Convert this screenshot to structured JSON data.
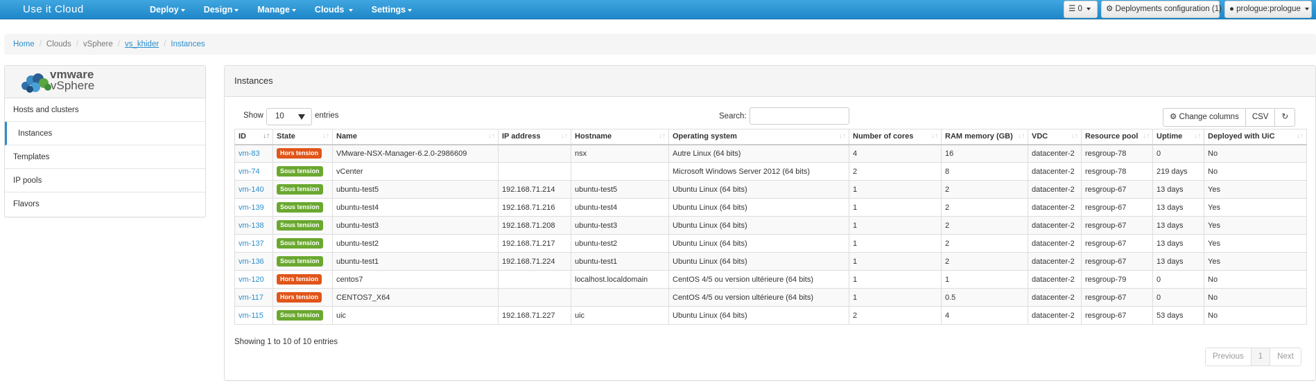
{
  "app": {
    "brand": "Use it Cloud"
  },
  "nav": {
    "menu": [
      {
        "label": "Deploy",
        "name": "nav-deploy"
      },
      {
        "label": "Design",
        "name": "nav-design"
      },
      {
        "label": "Manage",
        "name": "nav-manage"
      },
      {
        "label": "Clouds",
        "name": "nav-clouds"
      },
      {
        "label": "Settings",
        "name": "nav-settings"
      }
    ],
    "tasks_count": "0",
    "deployments_config": "Deployments configuration (1)",
    "user": "prologue:prologue"
  },
  "breadcrumb": [
    "Home",
    "Clouds",
    "vSphere",
    "vs_khider",
    "Instances"
  ],
  "sidebar": {
    "logo_vmware": "vmware",
    "logo_vsphere": "vSphere",
    "items": [
      {
        "label": "Hosts and clusters",
        "active": false
      },
      {
        "label": "Instances",
        "active": true
      },
      {
        "label": "Templates",
        "active": false
      },
      {
        "label": "IP pools",
        "active": false
      },
      {
        "label": "Flavors",
        "active": false
      }
    ]
  },
  "panel": {
    "title": "Instances",
    "show_label": "Show",
    "page_size": "10",
    "entries_label": "entries",
    "search_label": "Search:",
    "search_value": "",
    "change_columns": "Change columns",
    "csv": "CSV",
    "showing": "Showing 1 to 10 of 10 entries",
    "pagination": {
      "previous": "Previous",
      "current": "1",
      "next": "Next"
    }
  },
  "table": {
    "columns": [
      "ID",
      "State",
      "Name",
      "IP address",
      "Hostname",
      "Operating system",
      "Number of cores",
      "RAM memory (GB)",
      "VDC",
      "Resource pool",
      "Uptime",
      "Deployed with UiC"
    ],
    "rows": [
      {
        "id": "vm-83",
        "state": "Hors tension",
        "state_on": false,
        "name": "VMware-NSX-Manager-6.2.0-2986609",
        "ip": "",
        "hostname": "nsx",
        "os": "Autre Linux (64 bits)",
        "cores": "4",
        "ram": "16",
        "vdc": "datacenter-2",
        "pool": "resgroup-78",
        "uptime": "0",
        "uic": "No"
      },
      {
        "id": "vm-74",
        "state": "Sous tension",
        "state_on": true,
        "name": "vCenter",
        "ip": "",
        "hostname": "",
        "os": "Microsoft Windows Server 2012 (64 bits)",
        "cores": "2",
        "ram": "8",
        "vdc": "datacenter-2",
        "pool": "resgroup-78",
        "uptime": "219 days",
        "uic": "No"
      },
      {
        "id": "vm-140",
        "state": "Sous tension",
        "state_on": true,
        "name": "ubuntu-test5",
        "ip": "192.168.71.214",
        "hostname": "ubuntu-test5",
        "os": "Ubuntu Linux (64 bits)",
        "cores": "1",
        "ram": "2",
        "vdc": "datacenter-2",
        "pool": "resgroup-67",
        "uptime": "13 days",
        "uic": "Yes"
      },
      {
        "id": "vm-139",
        "state": "Sous tension",
        "state_on": true,
        "name": "ubuntu-test4",
        "ip": "192.168.71.216",
        "hostname": "ubuntu-test4",
        "os": "Ubuntu Linux (64 bits)",
        "cores": "1",
        "ram": "2",
        "vdc": "datacenter-2",
        "pool": "resgroup-67",
        "uptime": "13 days",
        "uic": "Yes"
      },
      {
        "id": "vm-138",
        "state": "Sous tension",
        "state_on": true,
        "name": "ubuntu-test3",
        "ip": "192.168.71.208",
        "hostname": "ubuntu-test3",
        "os": "Ubuntu Linux (64 bits)",
        "cores": "1",
        "ram": "2",
        "vdc": "datacenter-2",
        "pool": "resgroup-67",
        "uptime": "13 days",
        "uic": "Yes"
      },
      {
        "id": "vm-137",
        "state": "Sous tension",
        "state_on": true,
        "name": "ubuntu-test2",
        "ip": "192.168.71.217",
        "hostname": "ubuntu-test2",
        "os": "Ubuntu Linux (64 bits)",
        "cores": "1",
        "ram": "2",
        "vdc": "datacenter-2",
        "pool": "resgroup-67",
        "uptime": "13 days",
        "uic": "Yes"
      },
      {
        "id": "vm-136",
        "state": "Sous tension",
        "state_on": true,
        "name": "ubuntu-test1",
        "ip": "192.168.71.224",
        "hostname": "ubuntu-test1",
        "os": "Ubuntu Linux (64 bits)",
        "cores": "1",
        "ram": "2",
        "vdc": "datacenter-2",
        "pool": "resgroup-67",
        "uptime": "13 days",
        "uic": "Yes"
      },
      {
        "id": "vm-120",
        "state": "Hors tension",
        "state_on": false,
        "name": "centos7",
        "ip": "",
        "hostname": "localhost.localdomain",
        "os": "CentOS 4/5 ou version ultérieure (64 bits)",
        "cores": "1",
        "ram": "1",
        "vdc": "datacenter-2",
        "pool": "resgroup-79",
        "uptime": "0",
        "uic": "No"
      },
      {
        "id": "vm-117",
        "state": "Hors tension",
        "state_on": false,
        "name": "CENTOS7_X64",
        "ip": "",
        "hostname": "",
        "os": "CentOS 4/5 ou version ultérieure (64 bits)",
        "cores": "1",
        "ram": "0.5",
        "vdc": "datacenter-2",
        "pool": "resgroup-67",
        "uptime": "0",
        "uic": "No"
      },
      {
        "id": "vm-115",
        "state": "Sous tension",
        "state_on": true,
        "name": "uic",
        "ip": "192.168.71.227",
        "hostname": "uic",
        "os": "Ubuntu Linux (64 bits)",
        "cores": "2",
        "ram": "4",
        "vdc": "datacenter-2",
        "pool": "resgroup-67",
        "uptime": "53 days",
        "uic": "No"
      }
    ]
  },
  "colors": {
    "navbar": "#2a96d6",
    "link": "#2a8fcd",
    "state_on": "#6aa82f",
    "state_off": "#e0551a"
  }
}
